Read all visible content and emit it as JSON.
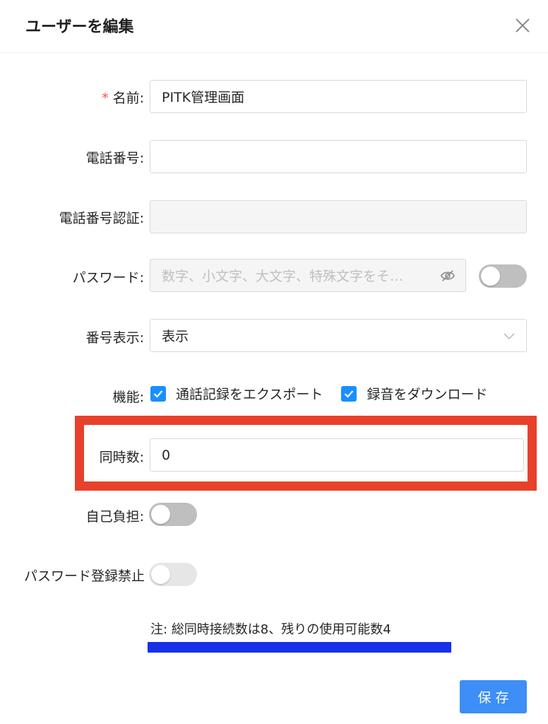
{
  "modal": {
    "title": "ユーザーを編集"
  },
  "form": {
    "name": {
      "required_mark": "*",
      "label": "名前:",
      "value": "PITK管理画面"
    },
    "phone": {
      "label": "電話番号:",
      "value": ""
    },
    "phone_verify": {
      "label": "電話番号認証:",
      "value": ""
    },
    "password": {
      "label": "パスワード:",
      "placeholder": "数字、小文字、大文字、特殊文字をそ…",
      "switch_on": false
    },
    "number_display": {
      "label": "番号表示:",
      "selected": "表示"
    },
    "features": {
      "label": "機能:",
      "options": [
        {
          "label": "通話記録をエクスポート",
          "checked": true
        },
        {
          "label": "録音をダウンロード",
          "checked": true
        }
      ]
    },
    "concurrency": {
      "label": "同時数:",
      "value": "0"
    },
    "self_pay": {
      "label": "自己負担:",
      "switch_on": false
    },
    "password_reg_ban": {
      "label": "パスワード登録禁止:",
      "switch_on": false
    }
  },
  "note": "注:  総同時接続数は8、残りの使用可能数4",
  "save_label": "保存",
  "colors": {
    "primary": "#1890ff",
    "save_button": "#3d8ef6",
    "required": "#ff4d4f",
    "annotation_red": "#e8412a",
    "annotation_blue": "#1730e8"
  }
}
